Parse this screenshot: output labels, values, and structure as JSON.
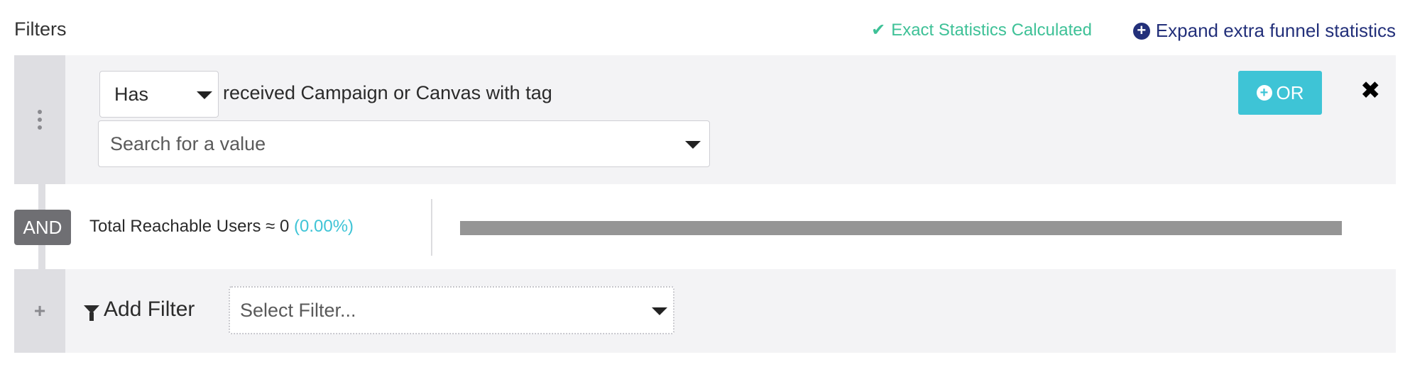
{
  "header": {
    "title": "Filters",
    "status": "Exact Statistics Calculated",
    "expand_label": "Expand extra funnel statistics",
    "status_color": "#3ec197",
    "link_color": "#23307a"
  },
  "filter": {
    "has_value": "Has",
    "rule_text": "received Campaign or Canvas with tag",
    "value_placeholder": "Search for a value",
    "or_label": "OR",
    "close_symbol": "✖"
  },
  "reach": {
    "and_label": "AND",
    "label": "Total Reachable Users ≈ 0",
    "percent": "(0.00%)",
    "percent_color": "#3ec4d6"
  },
  "add_filter": {
    "plus": "+",
    "label": "Add Filter",
    "select_placeholder": "Select Filter..."
  },
  "icons": [
    "checkmark-icon",
    "plus-circle-icon",
    "drag-handle-icon",
    "caret-down-icon",
    "close-icon",
    "plus-icon",
    "funnel-icon"
  ]
}
